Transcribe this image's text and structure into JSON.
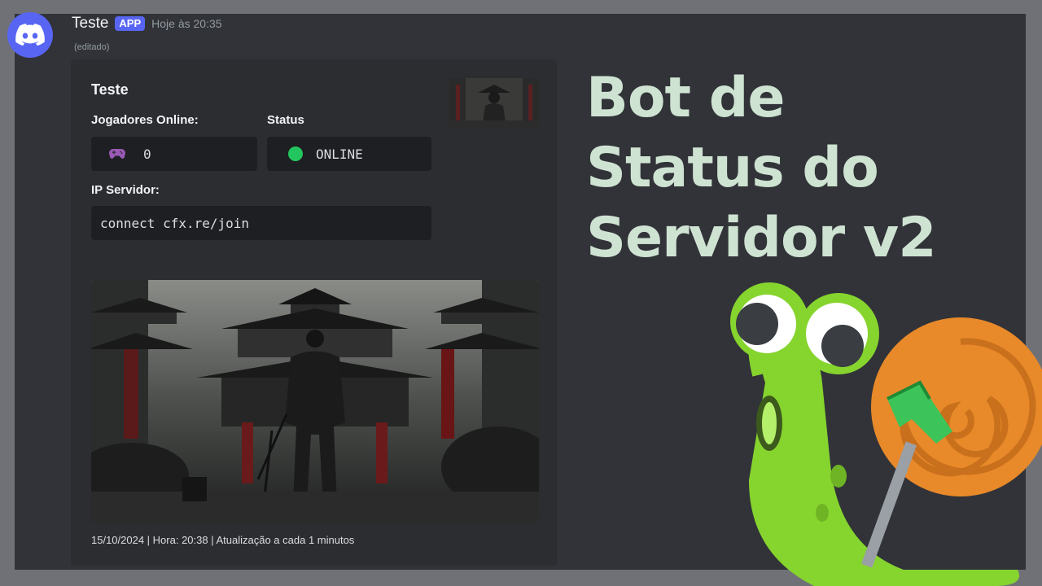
{
  "message": {
    "username": "Teste",
    "badge": "APP",
    "timestamp": "Hoje às 20:35",
    "edited": "(editado)"
  },
  "embed": {
    "title": "Teste",
    "fields": {
      "players_label": "Jogadores Online:",
      "players_value": "0",
      "status_label": "Status",
      "status_value": "ONLINE",
      "ip_label": "IP Servidor:",
      "ip_value": "connect cfx.re/join"
    },
    "footer": "15/10/2024 | Hora: 20:38 | Atualização a cada 1 minutos"
  },
  "headline": {
    "line1": "Bot de",
    "line2": "Status do",
    "line3": "Servidor v2"
  },
  "colors": {
    "accent": "#5865F2",
    "status_online": "#23c55e",
    "headline": "#cfe3d2"
  },
  "icons": {
    "avatar": "discord-logo-icon",
    "players": "gamepad-icon",
    "status": "status-dot-icon"
  }
}
